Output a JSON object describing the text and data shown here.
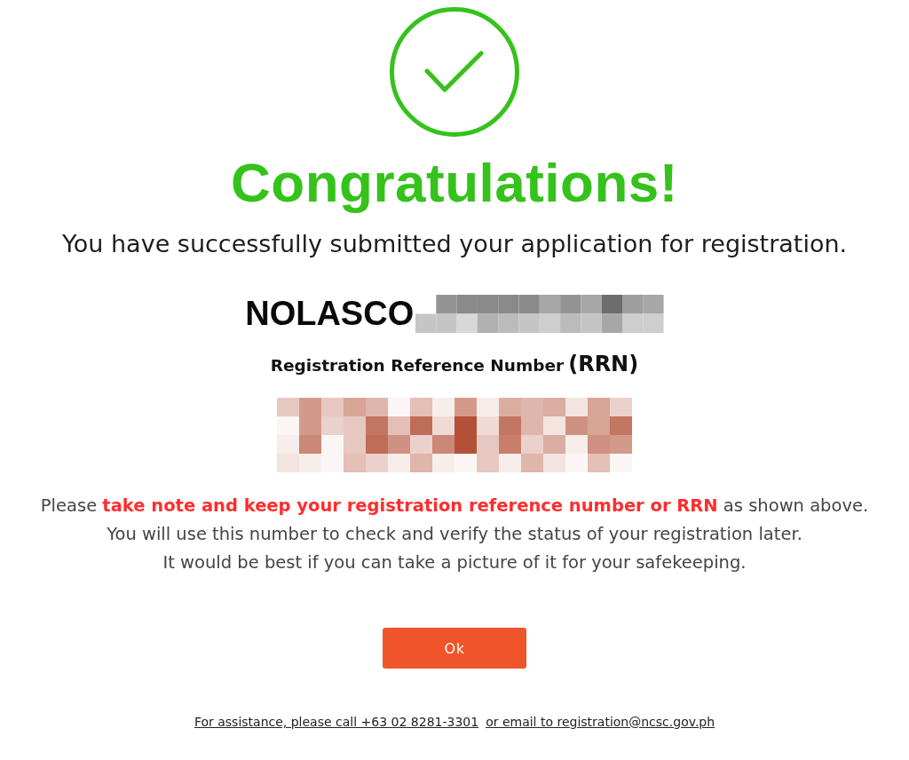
{
  "heading": "Congratulations!",
  "message": "You have successfully submitted your application for registration.",
  "applicant": {
    "surname": "NOLASCO"
  },
  "reference": {
    "label": "Registration Reference Number",
    "abbreviation": "(RRN)"
  },
  "notes": [
    "Please **take note and keep your registration reference number or RRN** as shown above.",
    "You will use this number to check and verify the status of your registration later.",
    "It would be best if you can take a picture of it for your safekeeping."
  ],
  "button": {
    "label": "Ok"
  },
  "footer": {
    "links": [
      "For assistance, please call +63 02 8281-3301",
      "or email to registration@ncsc.gov.ph"
    ]
  }
}
